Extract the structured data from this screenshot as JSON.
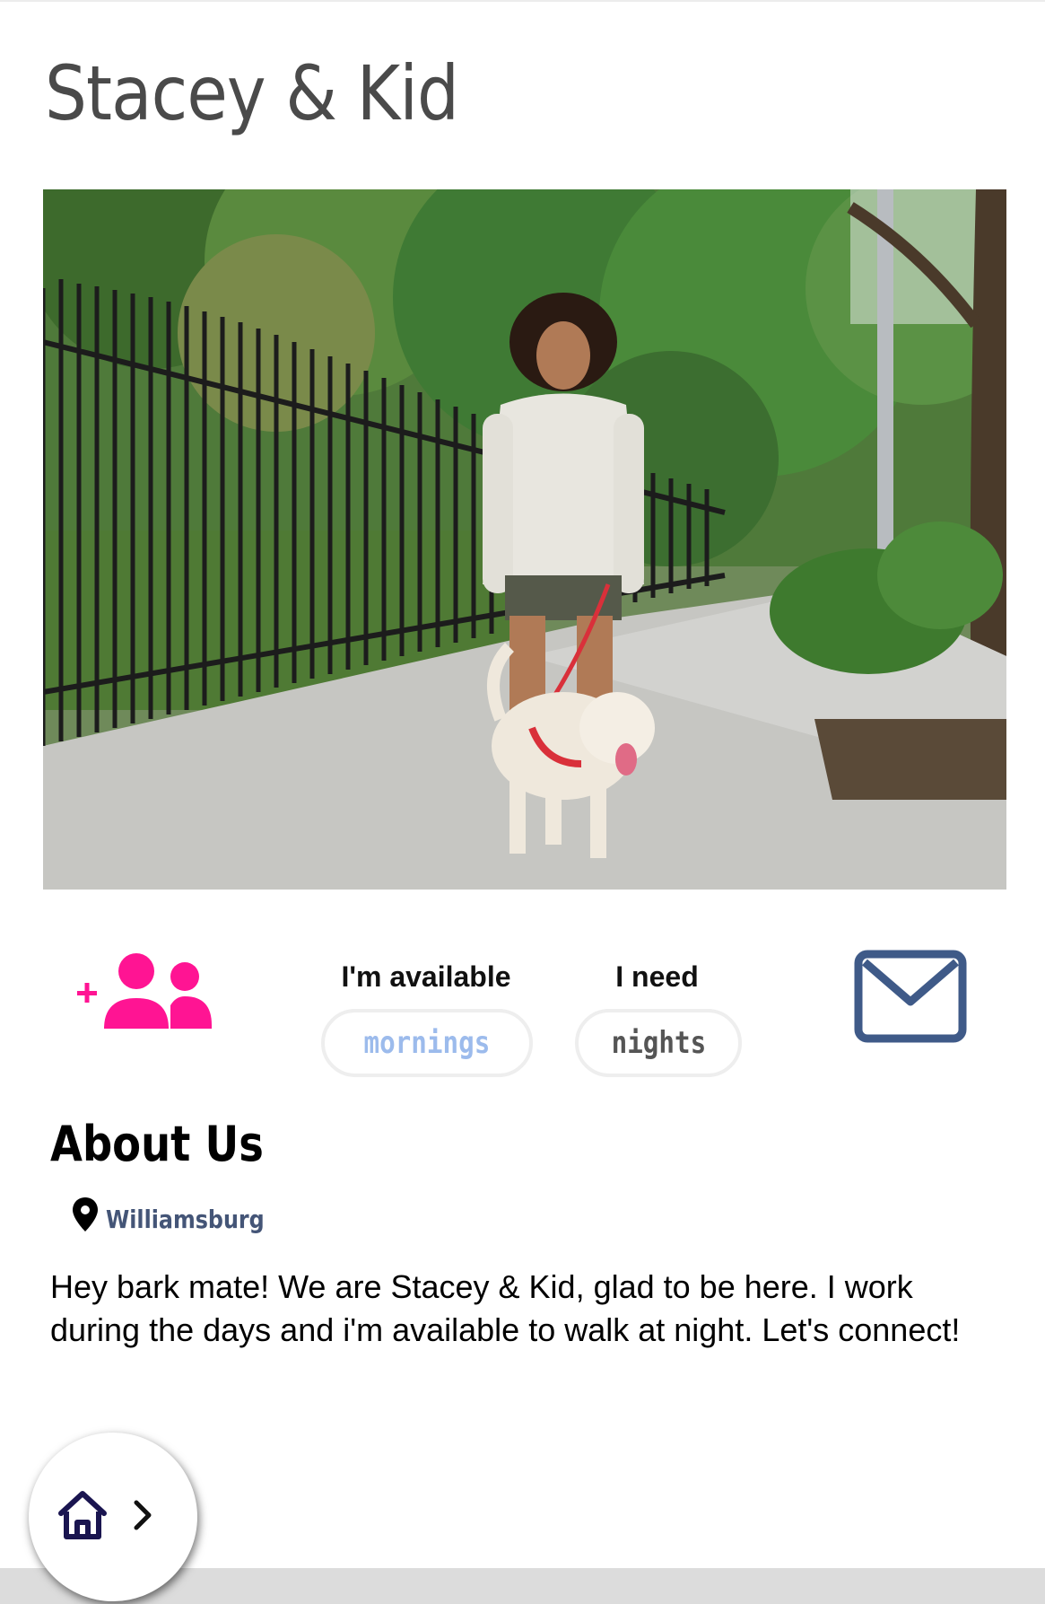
{
  "profile": {
    "title": "Stacey & Kid"
  },
  "photo": {
    "alt": "Woman in a white hoodie walking a white dog on a red leash along a tree-lined sidewalk"
  },
  "schedule": {
    "available_label": "I'm available",
    "available_value": "mornings",
    "need_label": "I need",
    "need_value": "nights"
  },
  "about": {
    "heading": "About Us",
    "location": "Williamsburg",
    "bio": "Hey bark mate! We are Stacey & Kid, glad to be here. I work during the days and i'm available to walk at night. Let's connect!"
  },
  "icons": {
    "add_friend": "add-friends-icon",
    "message": "envelope-icon",
    "location": "map-pin-icon",
    "home": "home-icon",
    "chevron": "chevron-right-icon"
  },
  "colors": {
    "accent_pink": "#ff1493",
    "mail_blue": "#3f5a88",
    "available_blue": "#9cbbec",
    "location_text": "#445577",
    "home_navy": "#1a1550"
  }
}
